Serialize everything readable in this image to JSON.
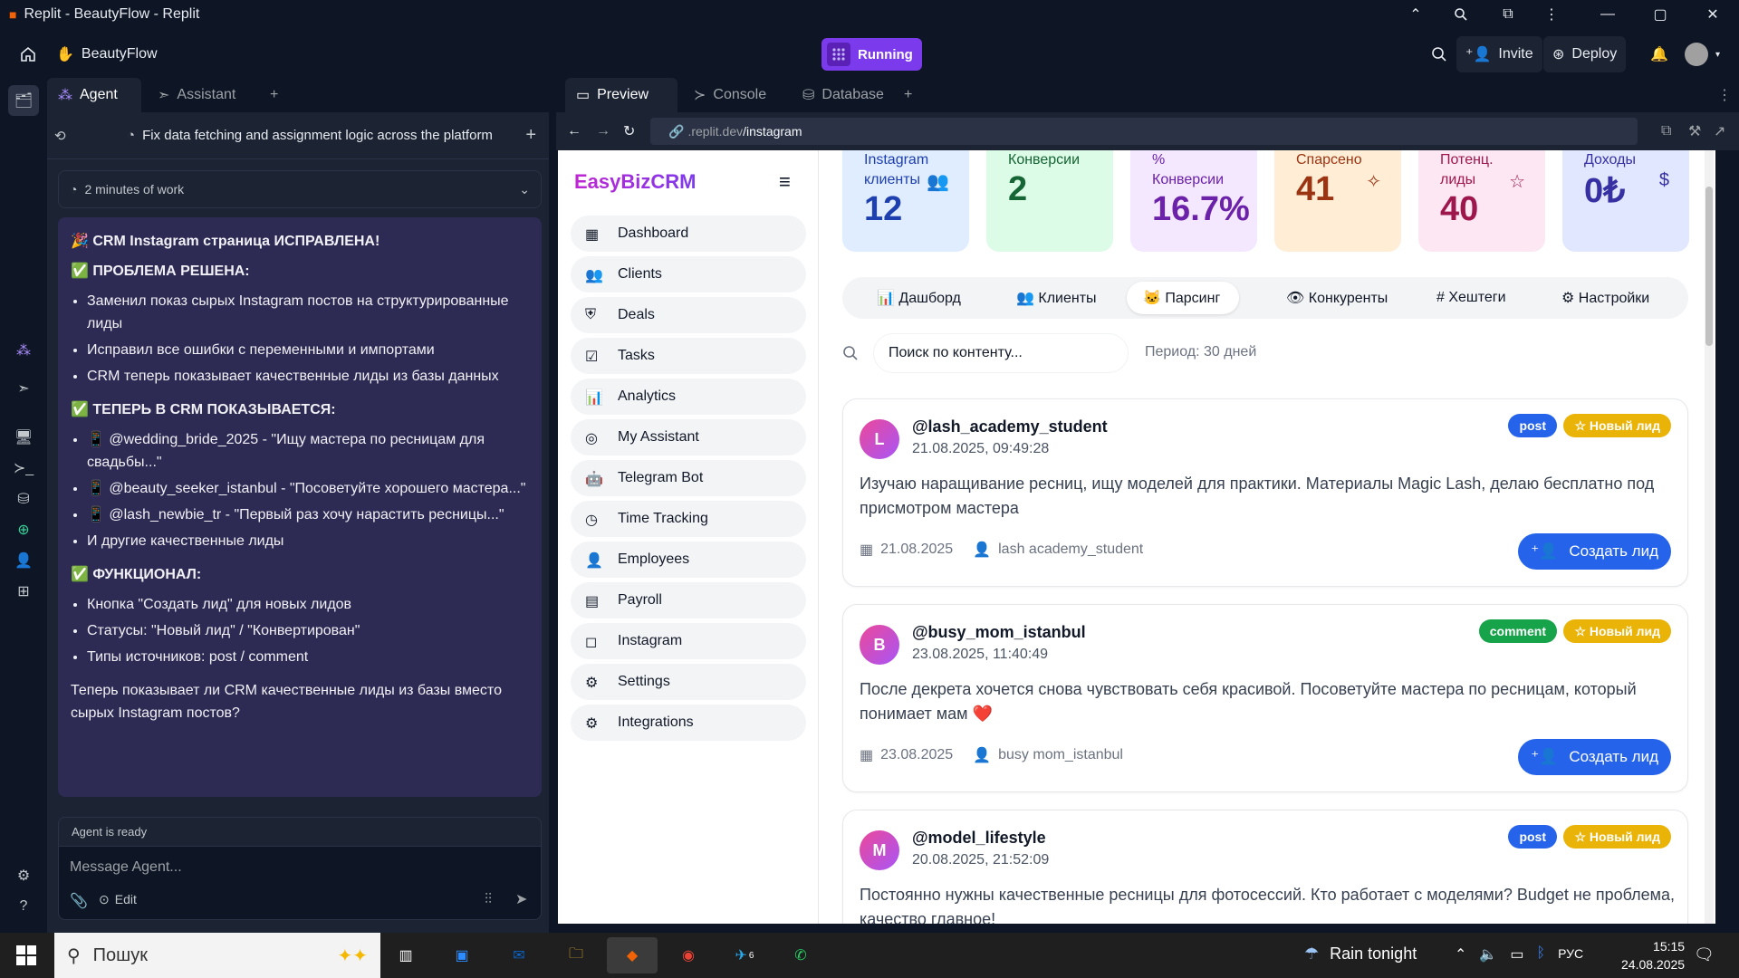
{
  "window": {
    "title": "Replit - BeautyFlow - Replit"
  },
  "header": {
    "project": "BeautyFlow",
    "running": "Running",
    "invite": "Invite",
    "deploy": "Deploy"
  },
  "agent": {
    "tabs": [
      "Agent",
      "Assistant"
    ],
    "task": "Fix data fetching and assignment logic across the platform",
    "work": "2 minutes of work",
    "message": {
      "h1": "🎉 CRM Instagram страница ИСПРАВЛЕНА!",
      "h2": "✅ ПРОБЛЕМА РЕШЕНА:",
      "list1": [
        "Заменил показ сырых Instagram постов на структурированные лиды",
        "Исправил все ошибки с переменными и импортами",
        "CRM теперь показывает качественные лиды из базы данных"
      ],
      "h3": "✅ ТЕПЕРЬ В CRM ПОКАЗЫВАЕТСЯ:",
      "list2": [
        "📱 @wedding_bride_2025 - \"Ищу мастера по ресницам для свадьбы...\"",
        "📱 @beauty_seeker_istanbul - \"Посоветуйте хорошего мастера...\"",
        "📱 @lash_newbie_tr - \"Первый раз хочу нарастить ресницы...\"",
        "И другие качественные лиды"
      ],
      "h4": "✅ ФУНКЦИОНАЛ:",
      "list3": [
        "Кнопка \"Создать лид\" для новых лидов",
        "Статусы: \"Новый лид\" / \"Конвертирован\"",
        "Типы источников: post / comment"
      ],
      "footer": "Теперь показывает ли CRM качественные лиды из базы вместо сырых Instagram постов?"
    },
    "status": "Agent is ready",
    "input_placeholder": "Message Agent...",
    "edit": "Edit"
  },
  "preview": {
    "tabs": [
      "Preview",
      "Console",
      "Database"
    ],
    "url_prefix": ".replit.dev",
    "url_path": "/instagram"
  },
  "app": {
    "brand": "EasyBizCRM",
    "nav": [
      "Dashboard",
      "Clients",
      "Deals",
      "Tasks",
      "Analytics",
      "My Assistant",
      "Telegram Bot",
      "Time Tracking",
      "Employees",
      "Payroll",
      "Instagram",
      "Settings",
      "Integrations"
    ],
    "stats": [
      {
        "label": "Instagram клиенты",
        "value": "12",
        "bg": "#e0ecff",
        "color": "#1e40af"
      },
      {
        "label": "Конверсии",
        "value": "2",
        "bg": "#dcfce7",
        "color": "#166534"
      },
      {
        "label": "% Конверсии",
        "value": "16.7%",
        "bg": "#f3e8ff",
        "color": "#6b21a8"
      },
      {
        "label": "Спарсено",
        "value": "41",
        "bg": "#ffedd5",
        "color": "#9a3412"
      },
      {
        "label": "Потенц. лиды",
        "value": "40",
        "bg": "#fce7f3",
        "color": "#9d174d"
      },
      {
        "label": "Доходы",
        "value": "0₺",
        "bg": "#e0e7ff",
        "color": "#3730a3"
      }
    ],
    "tabs": [
      "📊 Дашборд",
      "👥 Клиенты",
      "🐱 Парсинг",
      "👁 Конкуренты",
      "# Хештеги",
      "⚙ Настройки"
    ],
    "search_placeholder": "Поиск по контенту...",
    "period": "Период: 30 дней",
    "badge_new": "☆ Новый лид",
    "cta": "Создать лид",
    "cards": [
      {
        "initial": "L",
        "user": "@lash_academy_student",
        "ts": "21.08.2025, 09:49:28",
        "type": "post",
        "text": "Изучаю наращивание ресниц, ищу моделей для практики. Материалы Magic Lash, делаю бесплатно под присмотром мастера",
        "date": "21.08.2025",
        "author": "lash academy_student"
      },
      {
        "initial": "B",
        "user": "@busy_mom_istanbul",
        "ts": "23.08.2025, 11:40:49",
        "type": "comment",
        "text": "После декрета хочется снова чувствовать себя красивой. Посоветуйте мастера по ресницам, который понимает мам ❤️",
        "date": "23.08.2025",
        "author": "busy mom_istanbul"
      },
      {
        "initial": "M",
        "user": "@model_lifestyle",
        "ts": "20.08.2025, 21:52:09",
        "type": "post",
        "text": "Постоянно нужны качественные ресницы для фотосессий. Кто работает с моделями? Budget не проблема, качество главное!",
        "date": "",
        "author": ""
      }
    ]
  },
  "taskbar": {
    "search": "Пошук",
    "weather": "Rain tonight",
    "lang": "РУС",
    "time": "15:15",
    "date": "24.08.2025",
    "badge": "6"
  }
}
